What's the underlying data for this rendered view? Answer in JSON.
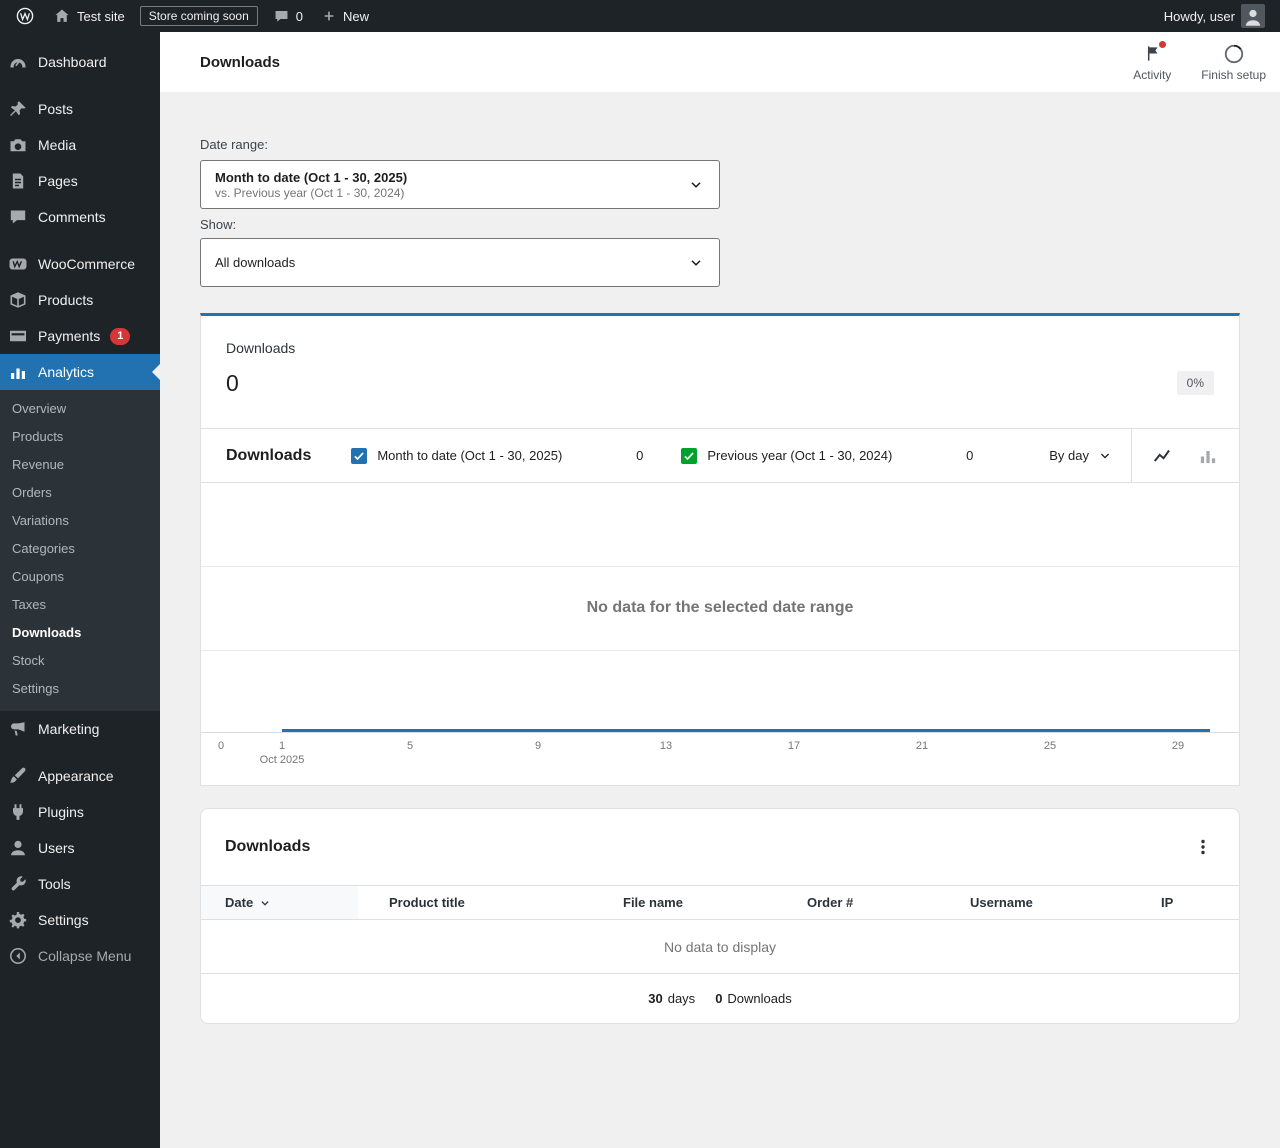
{
  "colors": {
    "accent_blue": "#2271b1",
    "series_primary": "#2271b1",
    "series_secondary": "#00a32a",
    "notification_red": "#d63638"
  },
  "admin_bar": {
    "site_name": "Test site",
    "coming_soon_badge": "Store coming soon",
    "comments_count": "0",
    "new_label": "New",
    "howdy": "Howdy, user"
  },
  "sidebar": {
    "items": [
      {
        "label": "Dashboard"
      },
      {
        "label": "Posts"
      },
      {
        "label": "Media"
      },
      {
        "label": "Pages"
      },
      {
        "label": "Comments"
      },
      {
        "label": "WooCommerce"
      },
      {
        "label": "Products"
      },
      {
        "label": "Payments",
        "badge": "1"
      },
      {
        "label": "Analytics"
      },
      {
        "label": "Marketing"
      },
      {
        "label": "Appearance"
      },
      {
        "label": "Plugins"
      },
      {
        "label": "Users"
      },
      {
        "label": "Tools"
      },
      {
        "label": "Settings"
      },
      {
        "label": "Collapse Menu"
      }
    ],
    "analytics_submenu": [
      "Overview",
      "Products",
      "Revenue",
      "Orders",
      "Variations",
      "Categories",
      "Coupons",
      "Taxes",
      "Downloads",
      "Stock",
      "Settings"
    ]
  },
  "header": {
    "title": "Downloads",
    "activity_label": "Activity",
    "finish_setup_label": "Finish setup"
  },
  "filters": {
    "date_range_label": "Date range:",
    "date_range_primary": "Month to date (Oct 1 - 30, 2025)",
    "date_range_secondary": "vs. Previous year (Oct 1 - 30, 2024)",
    "show_label": "Show:",
    "show_value": "All downloads"
  },
  "summary": {
    "label": "Downloads",
    "value": "0",
    "delta": "0%"
  },
  "chart": {
    "title": "Downloads",
    "legend": [
      {
        "label": "Month to date (Oct 1 - 30, 2025)",
        "value": "0"
      },
      {
        "label": "Previous year (Oct 1 - 30, 2024)",
        "value": "0"
      }
    ],
    "interval": "By day",
    "empty_message": "No data for the selected date range",
    "x_ticks": [
      "0",
      "1",
      "5",
      "9",
      "13",
      "17",
      "21",
      "25",
      "29"
    ],
    "x_axis_month": "Oct 2025"
  },
  "table": {
    "title": "Downloads",
    "columns": [
      "Date",
      "Product title",
      "File name",
      "Order #",
      "Username",
      "IP"
    ],
    "empty_message": "No data to display",
    "summary": {
      "days_value": "30",
      "days_label": "days",
      "downloads_value": "0",
      "downloads_label": "Downloads"
    }
  }
}
